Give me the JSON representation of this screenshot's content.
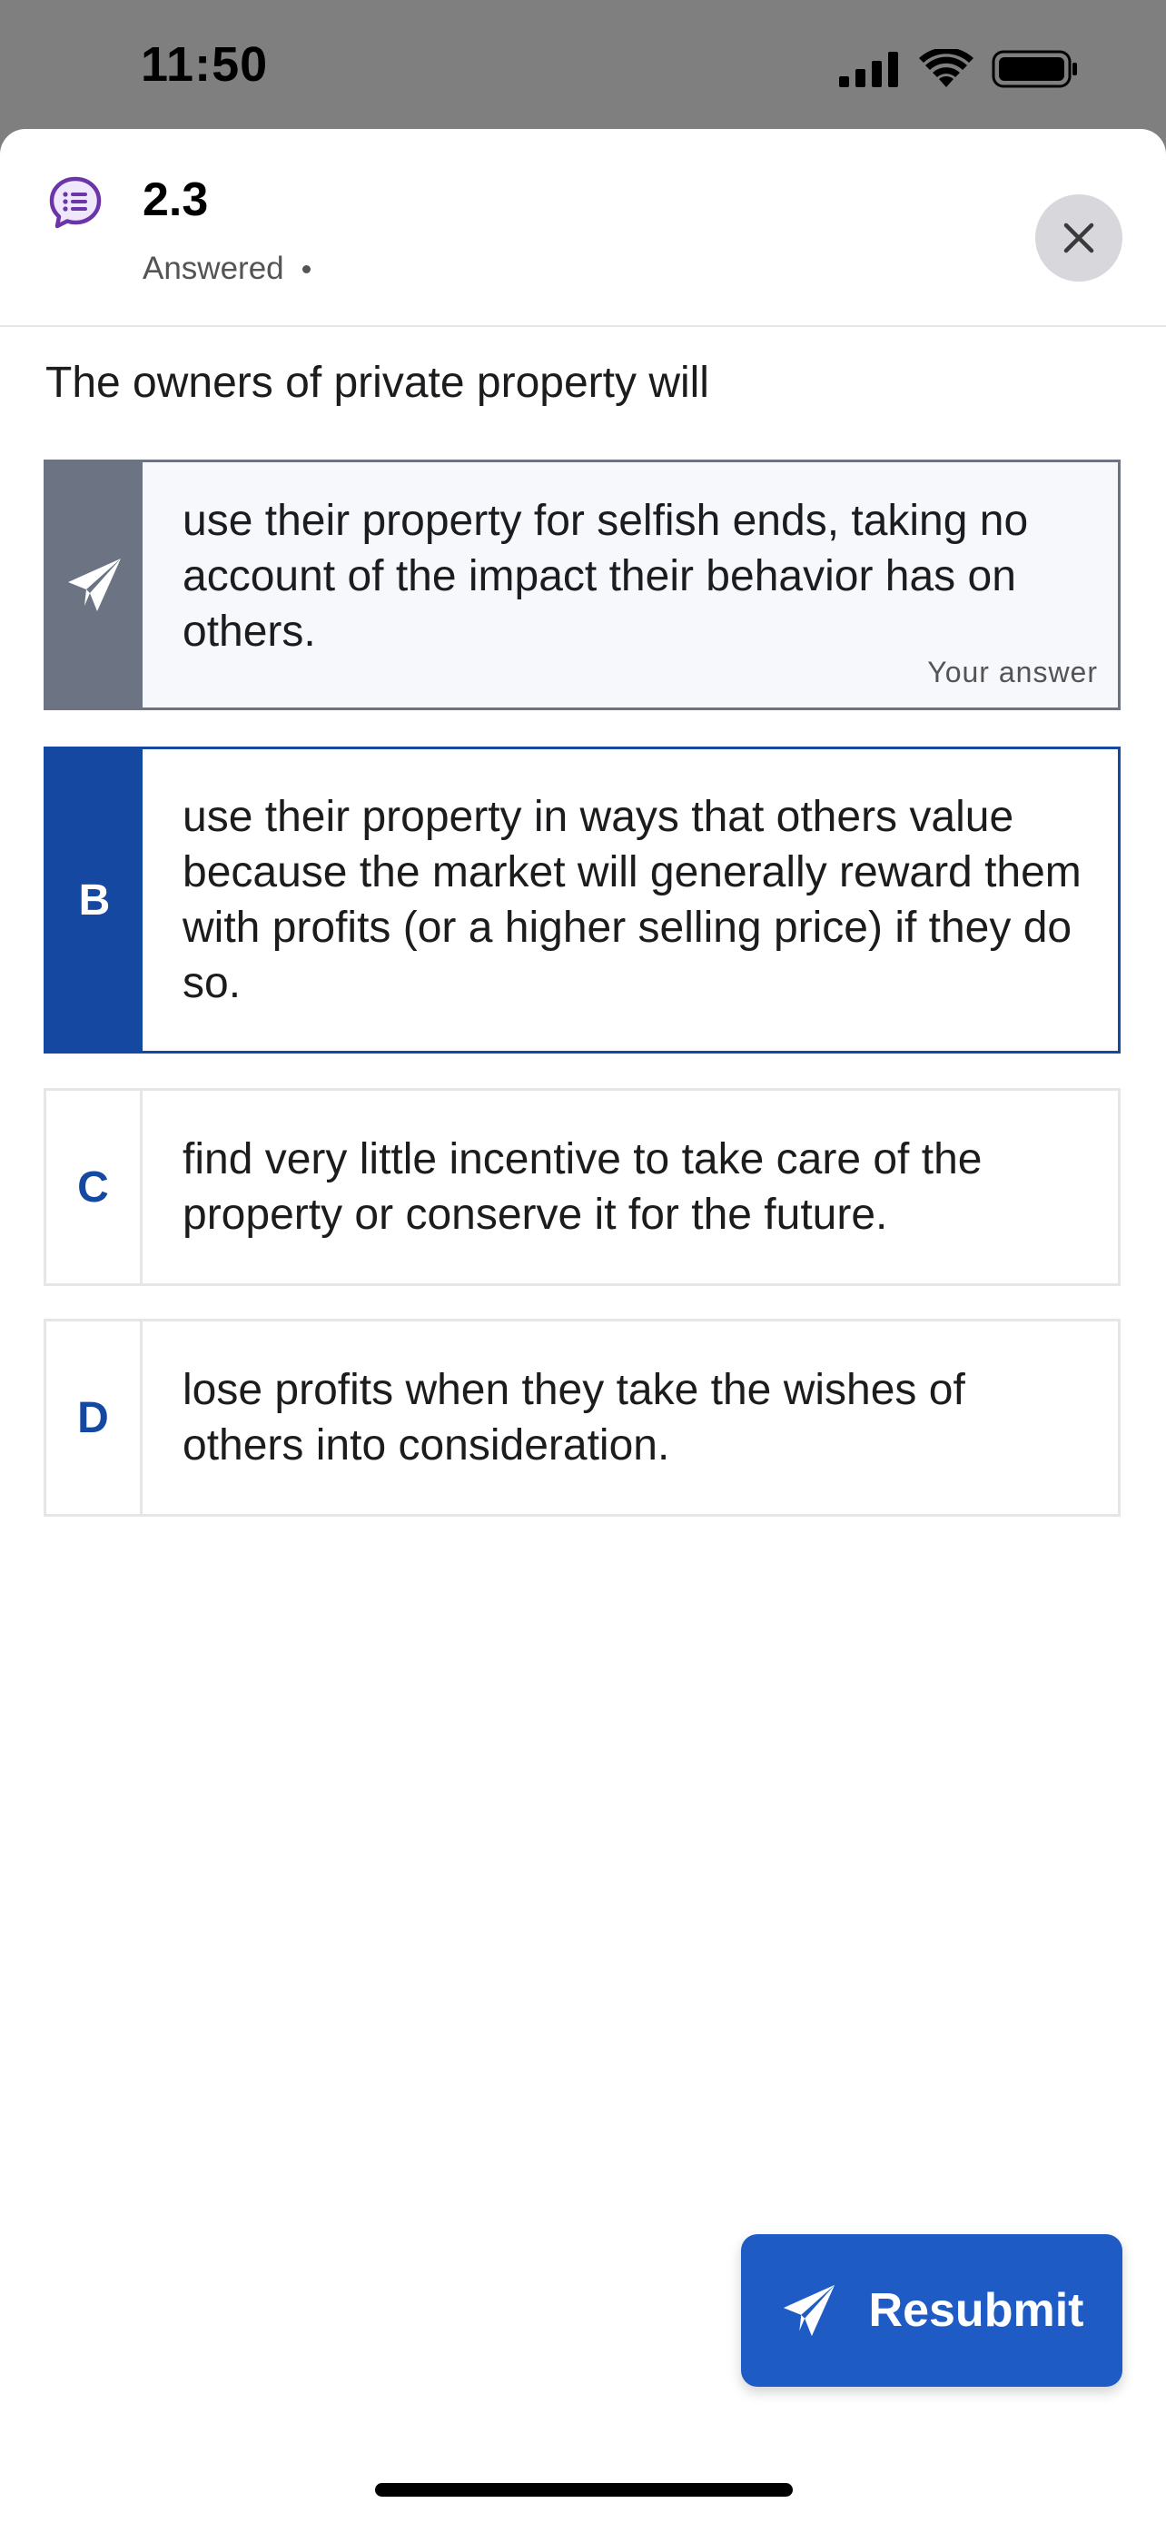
{
  "status_bar": {
    "time": "11:50",
    "icons": [
      "cellular-signal-icon",
      "wifi-icon",
      "battery-icon"
    ]
  },
  "header": {
    "icon": "poll-question-icon",
    "title": "2.3",
    "status": "Answered"
  },
  "question": {
    "text": "The owners of private property will"
  },
  "options": [
    {
      "key": "",
      "icon": "send-icon",
      "text": "use their property for selfish ends, taking no account of the impact their behavior has on others.",
      "note": "Your answer"
    },
    {
      "key": "B",
      "text": "use their property in ways that others value because the market will generally reward them with profits (or a higher selling price) if they do so."
    },
    {
      "key": "C",
      "text": "find very little incentive to take care of the property or conserve it for the future."
    },
    {
      "key": "D",
      "text": "lose profits when they take the wishes of others into consideration."
    }
  ],
  "actions": {
    "resubmit_label": "Resubmit"
  },
  "colors": {
    "accent": "#1548a1",
    "button": "#1f5bc5",
    "selected_gray": "#6c7483",
    "icon_purple": "#6b35a8"
  }
}
